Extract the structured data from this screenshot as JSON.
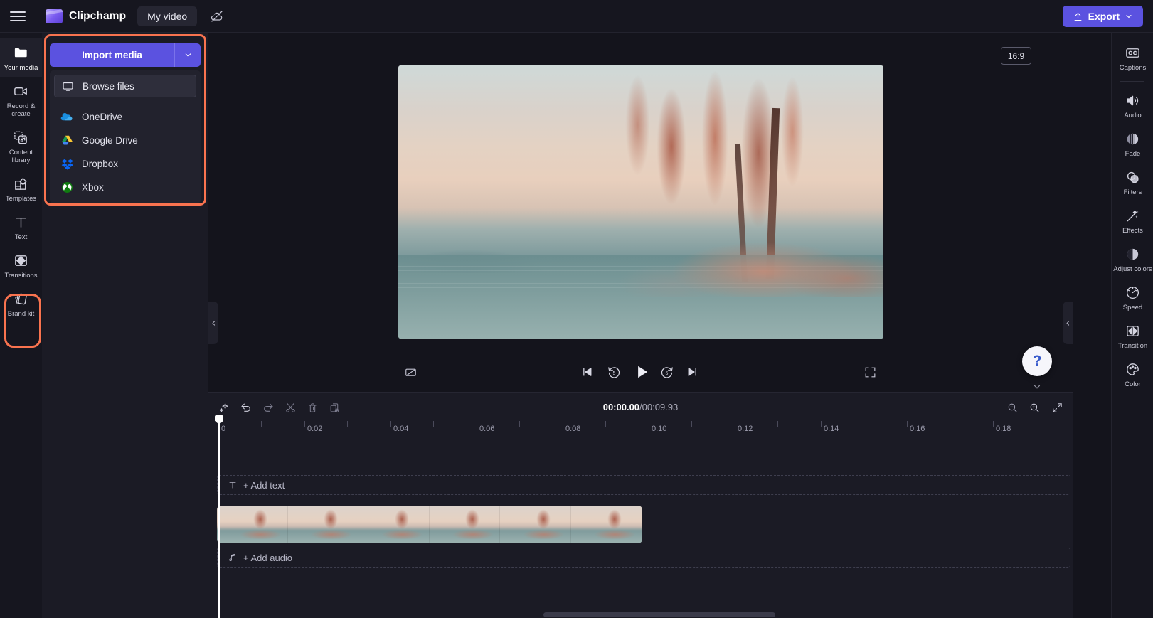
{
  "app": {
    "brand_name": "Clipchamp",
    "video_title": "My video",
    "export_label": "Export",
    "menu_icon": "hamburger-menu-icon",
    "cloud_icon": "cloud-off-icon"
  },
  "left_rail": {
    "items": [
      {
        "label": "Your media",
        "icon": "folder-icon",
        "active": true
      },
      {
        "label": "Record & create",
        "icon": "video-camera-icon",
        "active": false
      },
      {
        "label": "Content library",
        "icon": "content-library-icon",
        "active": false
      },
      {
        "label": "Templates",
        "icon": "templates-icon",
        "active": false
      },
      {
        "label": "Text",
        "icon": "text-icon",
        "active": false
      },
      {
        "label": "Transitions",
        "icon": "transitions-icon",
        "active": false
      },
      {
        "label": "Brand kit",
        "icon": "brand-kit-icon",
        "active": false
      }
    ],
    "highlight_item": "Brand kit",
    "highlight_color": "#f9734f"
  },
  "import_panel": {
    "import_button_label": "Import media",
    "caret_icon": "chevron-down-icon",
    "browse_files_label": "Browse files",
    "browse_files_icon": "monitor-icon",
    "cloud_sources": [
      {
        "label": "OneDrive",
        "icon": "onedrive-icon"
      },
      {
        "label": "Google Drive",
        "icon": "google-drive-icon"
      },
      {
        "label": "Dropbox",
        "icon": "dropbox-icon"
      },
      {
        "label": "Xbox",
        "icon": "xbox-icon"
      }
    ],
    "highlight_color": "#f9734f"
  },
  "preview": {
    "aspect_ratio": "16:9",
    "controls": [
      {
        "name": "mute-toggle",
        "icon": "no-audio-icon"
      },
      {
        "name": "skip-to-start",
        "icon": "skip-start-icon"
      },
      {
        "name": "rewind-5",
        "icon": "rewind-5-icon"
      },
      {
        "name": "play",
        "icon": "play-icon"
      },
      {
        "name": "forward-5",
        "icon": "forward-5-icon"
      },
      {
        "name": "skip-to-end",
        "icon": "skip-end-icon"
      },
      {
        "name": "fullscreen",
        "icon": "fullscreen-icon"
      }
    ],
    "collapse_left_icon": "chevron-left-icon",
    "collapse_right_icon": "chevron-left-icon"
  },
  "right_rail": {
    "items": [
      {
        "label": "Captions",
        "icon": "closed-captions-icon"
      },
      {
        "label": "Audio",
        "icon": "speaker-icon"
      },
      {
        "label": "Fade",
        "icon": "fade-icon"
      },
      {
        "label": "Filters",
        "icon": "filters-icon"
      },
      {
        "label": "Effects",
        "icon": "magic-wand-icon"
      },
      {
        "label": "Adjust colors",
        "icon": "contrast-icon"
      },
      {
        "label": "Speed",
        "icon": "speedometer-icon"
      },
      {
        "label": "Transition",
        "icon": "transition-icon"
      },
      {
        "label": "Color",
        "icon": "palette-icon"
      }
    ]
  },
  "help": {
    "label": "?",
    "chevron_icon": "chevron-down-icon"
  },
  "timeline": {
    "toolbar": [
      {
        "name": "magic-tools-button",
        "icon": "sparkle-icon"
      },
      {
        "name": "undo-button",
        "icon": "undo-icon"
      },
      {
        "name": "redo-button",
        "icon": "redo-icon"
      },
      {
        "name": "split-button",
        "icon": "scissors-icon"
      },
      {
        "name": "delete-button",
        "icon": "trash-icon"
      },
      {
        "name": "duplicate-button",
        "icon": "duplicate-icon"
      }
    ],
    "zoom_controls": [
      {
        "name": "zoom-out-button",
        "icon": "zoom-out-icon"
      },
      {
        "name": "zoom-in-button",
        "icon": "zoom-in-icon"
      },
      {
        "name": "fit-button",
        "icon": "fit-to-screen-icon"
      }
    ],
    "current_time": "00:00.00",
    "separator": " / ",
    "total_time": "00:09.93",
    "ruler_labels": [
      "0",
      "0:02",
      "0:04",
      "0:06",
      "0:08",
      "0:10",
      "0:12",
      "0:14",
      "0:16",
      "0:18"
    ],
    "add_text_label": "+ Add text",
    "add_text_icon": "text-icon",
    "add_audio_label": "+ Add audio",
    "add_audio_icon": "music-note-icon"
  }
}
